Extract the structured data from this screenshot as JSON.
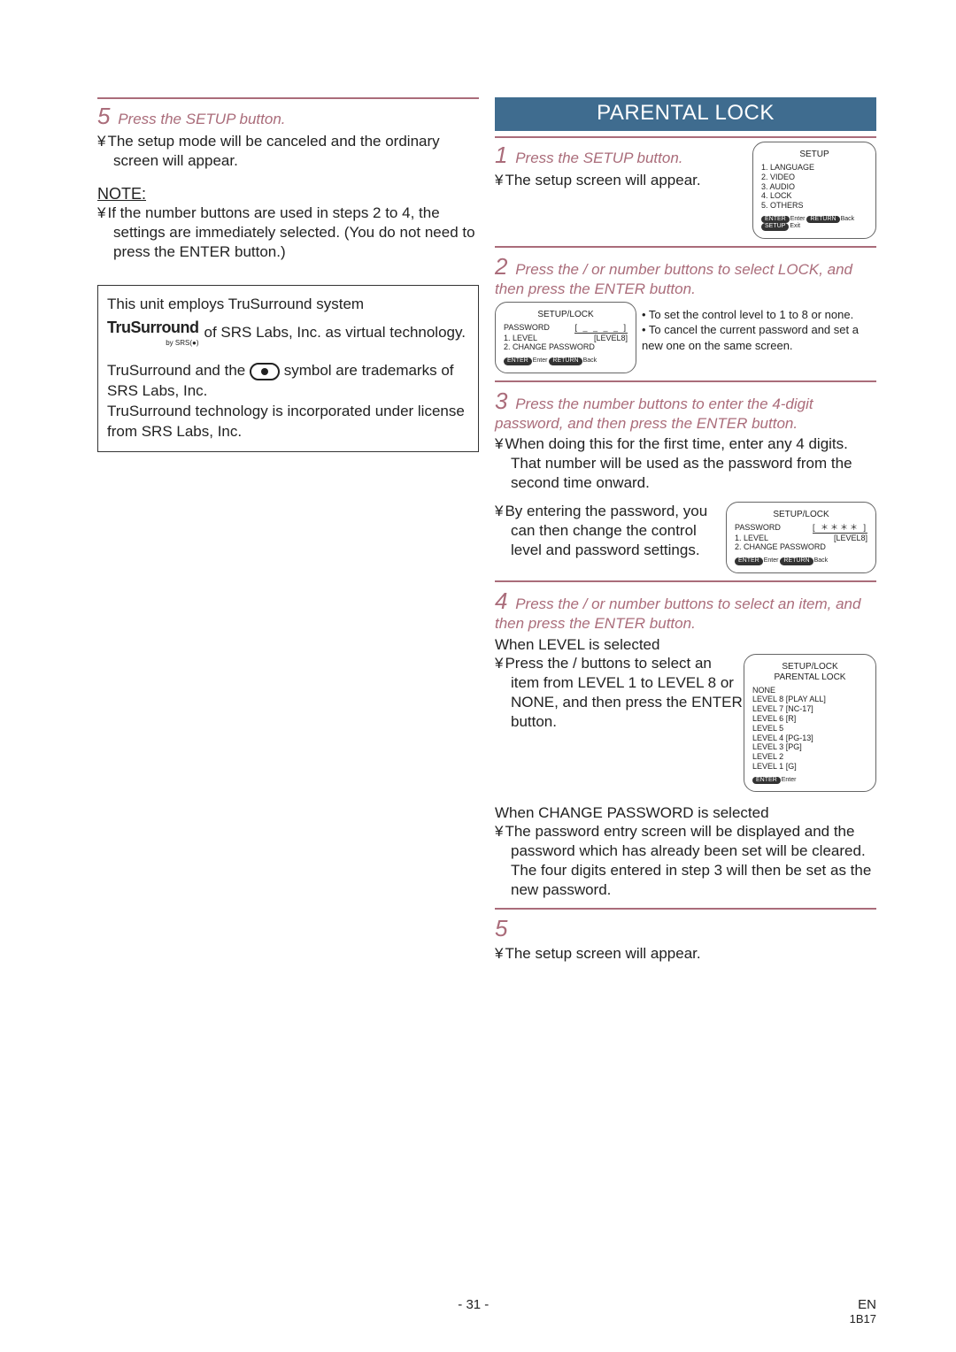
{
  "left": {
    "step5_hdr": "Press the SETUP button.",
    "step5_num": "5",
    "step5_body": "The setup mode will be canceled and the ordinary screen will appear.",
    "note_hdr": "NOTE:",
    "note_body": "If the number buttons are used in steps 2 to 4, the settings are immediately selected. (You do not need to press the ENTER button.)",
    "box_line1": "This unit employs TruSurround system",
    "box_line2": " of SRS Labs, Inc. as virtual technology.",
    "box2_a": "TruSurround and the ",
    "box2_b": " symbol are trademarks of SRS Labs, Inc.",
    "box2_c": "TruSurround technology is incorporated under license from SRS Labs, Inc.",
    "srs_ts": "TruSurround",
    "srs_by": "by SRS(●)"
  },
  "right": {
    "banner": "PARENTAL LOCK",
    "s1_num": "1",
    "s1_hdr": "Press the SETUP button.",
    "s1_body": "The setup screen will appear.",
    "s2_num": "2",
    "s2_hdr": "Press the   /   or number buttons to select LOCK, and then press the ENTER button.",
    "s2_n1": "• To set the control level to 1 to 8 or none.",
    "s2_n2": "• To cancel the current password and set a new one on the same screen.",
    "s3_num": "3",
    "s3_hdr": "Press the number buttons to enter the 4-digit password, and then press the ENTER button.",
    "s3_b1": "When doing this for the first time, enter any 4 digits. That number will be used as the password from the second time onward.",
    "s3_b2": "By entering the password, you can then change the control level and password settings.",
    "s4_num": "4",
    "s4_hdr": "Press the   /   or number buttons to select an item, and then press the ENTER button.",
    "s4_when_level": "When LEVEL is selected",
    "s4_level_body": "Press the  /   buttons to select an item from LEVEL 1 to LEVEL 8 or NONE, and then press the ENTER button.",
    "s4_when_change": "When CHANGE PASSWORD is selected",
    "s4_change_body": "The password entry screen will be displayed and the password which has already been set will be cleared. The four digits entered in step 3 will then be set as the new password.",
    "s5_num": "5",
    "s5_body": "The setup screen will appear.",
    "setup_box": {
      "title": "SETUP",
      "items": [
        "1. LANGUAGE",
        "2. VIDEO",
        "3. AUDIO",
        "4. LOCK",
        "5. OTHERS"
      ],
      "footer_enter": "ENTER",
      "footer_enter_t": "Enter",
      "footer_return": "RETURN",
      "footer_return_t": "Back",
      "footer_setup": "SETUP",
      "footer_setup_t": "Exit"
    },
    "lock_box": {
      "title": "SETUP/LOCK",
      "pw_label": "PASSWORD",
      "pw_blank": "[ _  _  _  _ ]",
      "i1": "1. LEVEL",
      "i1v": "[LEVEL8]",
      "i2": "2. CHANGE PASSWORD"
    },
    "lock_box2": {
      "title": "SETUP/LOCK",
      "pw_label": "PASSWORD",
      "pw_filled": "[ ＊＊＊＊ ]",
      "i1": "1. LEVEL",
      "i1v": "[LEVEL8]",
      "i2": "2. CHANGE PASSWORD"
    },
    "pl_box": {
      "title1": "SETUP/LOCK",
      "title2": "PARENTAL LOCK",
      "items": [
        "NONE",
        "LEVEL 8  [PLAY ALL]",
        "LEVEL 7  [NC-17]",
        "LEVEL 6  [R]",
        "LEVEL 5",
        "LEVEL 4  [PG-13]",
        "LEVEL 3  [PG]",
        "LEVEL 2",
        "LEVEL 1  [G]"
      ]
    }
  },
  "footer": {
    "page": "- 31 -",
    "lang": "EN",
    "code": "1B17"
  }
}
